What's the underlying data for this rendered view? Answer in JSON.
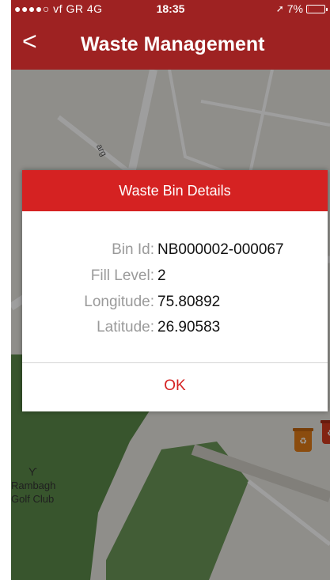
{
  "status_bar": {
    "carrier": "●●●●○ vf GR  4G",
    "time": "18:35",
    "location_icon": "location-arrow-icon",
    "battery_text": "7%",
    "battery_level": 0.07
  },
  "nav": {
    "back_icon": "chevron-left-icon",
    "back_glyph": "<",
    "title": "Waste Management"
  },
  "map": {
    "zoom_in": "+",
    "zoom_out": "−",
    "street_label": "arg",
    "place_icon": "golf-flag-icon",
    "place_icon_glyph": "ϒ",
    "place_line1": "Rambagh",
    "place_line2": "Golf Club",
    "bin_icon": "recycle-bin-icon"
  },
  "dialog": {
    "title": "Waste Bin Details",
    "fields": [
      {
        "label": "Bin Id:",
        "value": "NB000002-000067"
      },
      {
        "label": "Fill Level:",
        "value": "2"
      },
      {
        "label": "Longitude:",
        "value": "75.80892"
      },
      {
        "label": "Latitude:",
        "value": "26.90583"
      }
    ],
    "ok_label": "OK"
  },
  "colors": {
    "nav_bar": "#9e2222",
    "dialog_header": "#d52222",
    "ok_text": "#d52222",
    "map_base": "#e7e5df",
    "map_park": "#5b8a4a",
    "bin_orange": "#e07b18",
    "bin_red": "#d23a1e"
  }
}
